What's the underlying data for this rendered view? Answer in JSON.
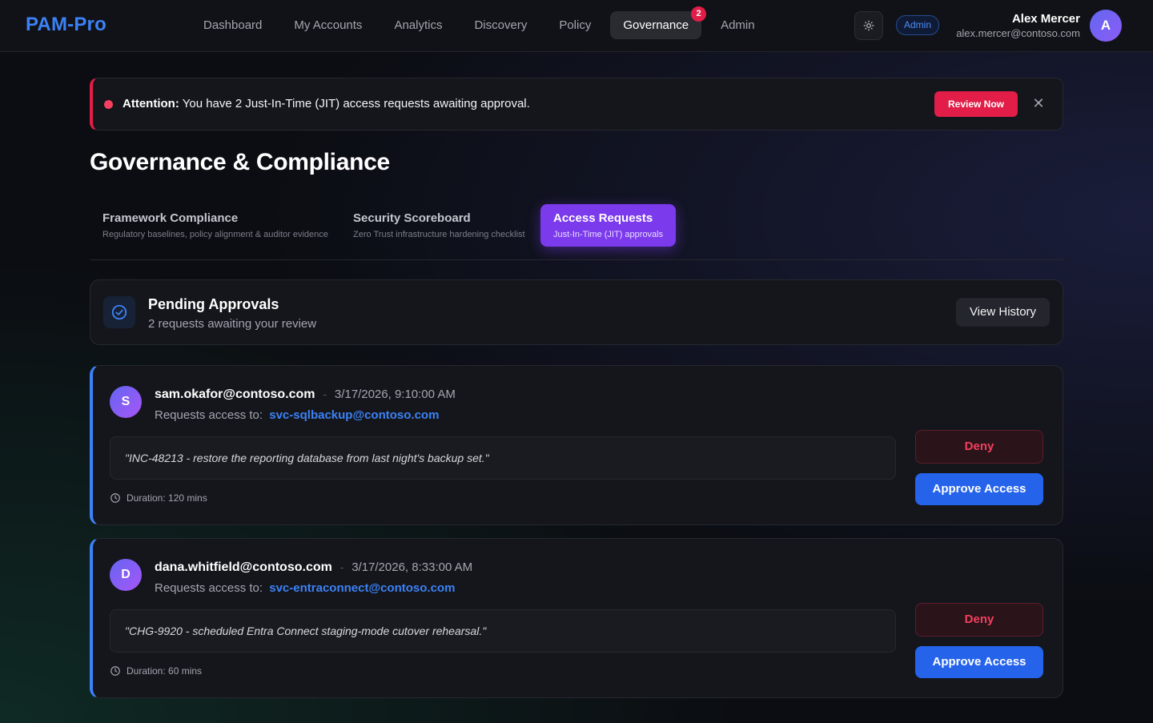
{
  "app": {
    "brand": "PAM-Pro"
  },
  "nav": {
    "items": [
      {
        "label": "Dashboard"
      },
      {
        "label": "My Accounts"
      },
      {
        "label": "Analytics"
      },
      {
        "label": "Discovery"
      },
      {
        "label": "Policy"
      },
      {
        "label": "Governance",
        "badge": "2",
        "active": true
      },
      {
        "label": "Admin"
      }
    ]
  },
  "header": {
    "theme_icon": "sun-icon",
    "role_badge": "Admin",
    "user_name": "Alex Mercer",
    "user_email": "alex.mercer@contoso.com",
    "avatar_initial": "A"
  },
  "alert": {
    "prefix": "Attention:",
    "message": "You have 2 Just-In-Time (JIT) access requests awaiting approval.",
    "action_label": "Review Now",
    "close_icon": "close-icon",
    "accent_color": "#e11d48"
  },
  "page": {
    "title": "Governance & Compliance"
  },
  "tabs": [
    {
      "title": "Framework Compliance",
      "subtitle": "Regulatory baselines, policy alignment & auditor evidence"
    },
    {
      "title": "Security Scoreboard",
      "subtitle": "Zero Trust infrastructure hardening checklist"
    },
    {
      "title": "Access Requests",
      "subtitle": "Just-In-Time (JIT) approvals",
      "active": true
    }
  ],
  "pending": {
    "icon": "check-circle-icon",
    "title": "Pending Approvals",
    "subtitle": "2 requests awaiting your review",
    "history_label": "View History"
  },
  "requests": [
    {
      "initial": "S",
      "email": "sam.okafor@contoso.com",
      "separator": "-",
      "time": "3/17/2026, 9:10:00 AM",
      "target_prefix": "Requests access to:",
      "target": "svc-sqlbackup@contoso.com",
      "reason": "\"INC-48213 - restore the reporting database from last night's backup set.\"",
      "duration": "Duration: 120 mins",
      "deny_label": "Deny",
      "approve_label": "Approve Access"
    },
    {
      "initial": "D",
      "email": "dana.whitfield@contoso.com",
      "separator": "-",
      "time": "3/17/2026, 8:33:00 AM",
      "target_prefix": "Requests access to:",
      "target": "svc-entraconnect@contoso.com",
      "reason": "\"CHG-9920 - scheduled Entra Connect staging-mode cutover rehearsal.\"",
      "duration": "Duration: 60 mins",
      "deny_label": "Deny",
      "approve_label": "Approve Access"
    }
  ],
  "colors": {
    "brand": "#3b82f6",
    "active_tab": "#7c3aed",
    "approve": "#2563eb",
    "deny": "#f43f5e",
    "badge": "#e11d48"
  }
}
